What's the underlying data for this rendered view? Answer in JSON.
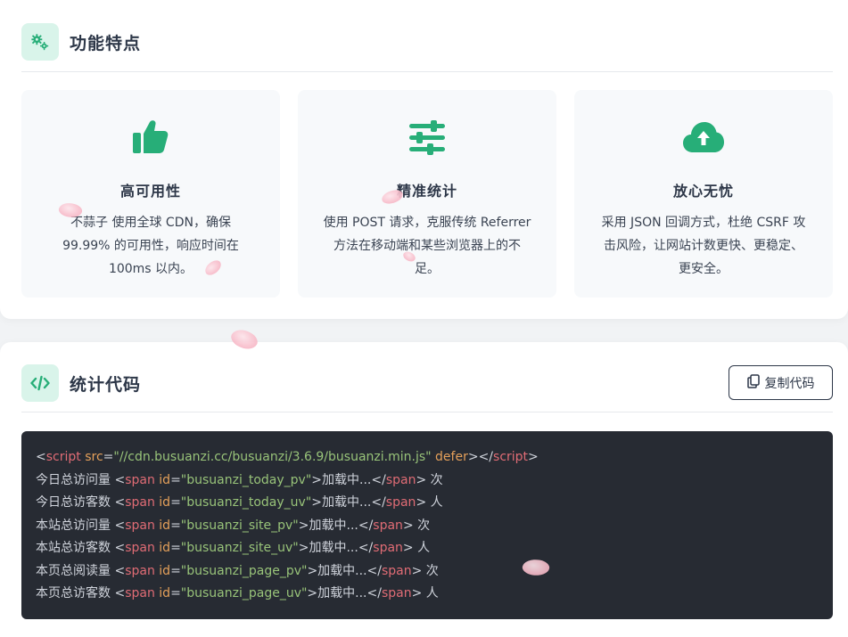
{
  "features": {
    "title": "功能特点",
    "items": [
      {
        "icon": "thumbs-up-icon",
        "title": "高可用性",
        "desc": "不蒜子 使用全球 CDN，确保 99.99% 的可用性，响应时间在 100ms 以内。"
      },
      {
        "icon": "sliders-icon",
        "title": "精准统计",
        "desc": "使用 POST 请求，克服传统 Referrer 方法在移动端和某些浏览器上的不足。"
      },
      {
        "icon": "cloud-upload-icon",
        "title": "放心无忧",
        "desc": "采用 JSON 回调方式，杜绝 CSRF 攻击风险，让网站计数更快、更稳定、更安全。"
      }
    ]
  },
  "code_section": {
    "title": "统计代码",
    "copy_label": "复制代码",
    "script_line": {
      "open": "<",
      "tag": "script",
      "attr": "src",
      "eq": "=",
      "value": "\"//cdn.busuanzi.cc/busuanzi/3.6.9/busuanzi.min.js\"",
      "defer": "defer",
      "close": "></",
      "end": ">"
    },
    "lines": [
      {
        "label": "今日总访问量 ",
        "id": "\"busuanzi_today_pv\"",
        "loading": ">加载中...</",
        "unit": "> 次"
      },
      {
        "label": "今日总访客数 ",
        "id": "\"busuanzi_today_uv\"",
        "loading": ">加载中...</",
        "unit": "> 人"
      },
      {
        "label": "本站总访问量 ",
        "id": "\"busuanzi_site_pv\"",
        "loading": ">加载中...</",
        "unit": "> 次"
      },
      {
        "label": "本站总访客数 ",
        "id": "\"busuanzi_site_uv\"",
        "loading": ">加载中...</",
        "unit": "> 人"
      },
      {
        "label": "本页总阅读量 ",
        "id": "\"busuanzi_page_pv\"",
        "loading": ">加载中...</",
        "unit": "> 次"
      },
      {
        "label": "本页总访客数 ",
        "id": "\"busuanzi_page_uv\"",
        "loading": ">加载中...</",
        "unit": "> 人"
      }
    ],
    "span_tag": "span",
    "id_attr": "id"
  },
  "colors": {
    "accent": "#27ae78",
    "icon_bg": "#d9f4ea",
    "code_bg": "#272b33"
  }
}
